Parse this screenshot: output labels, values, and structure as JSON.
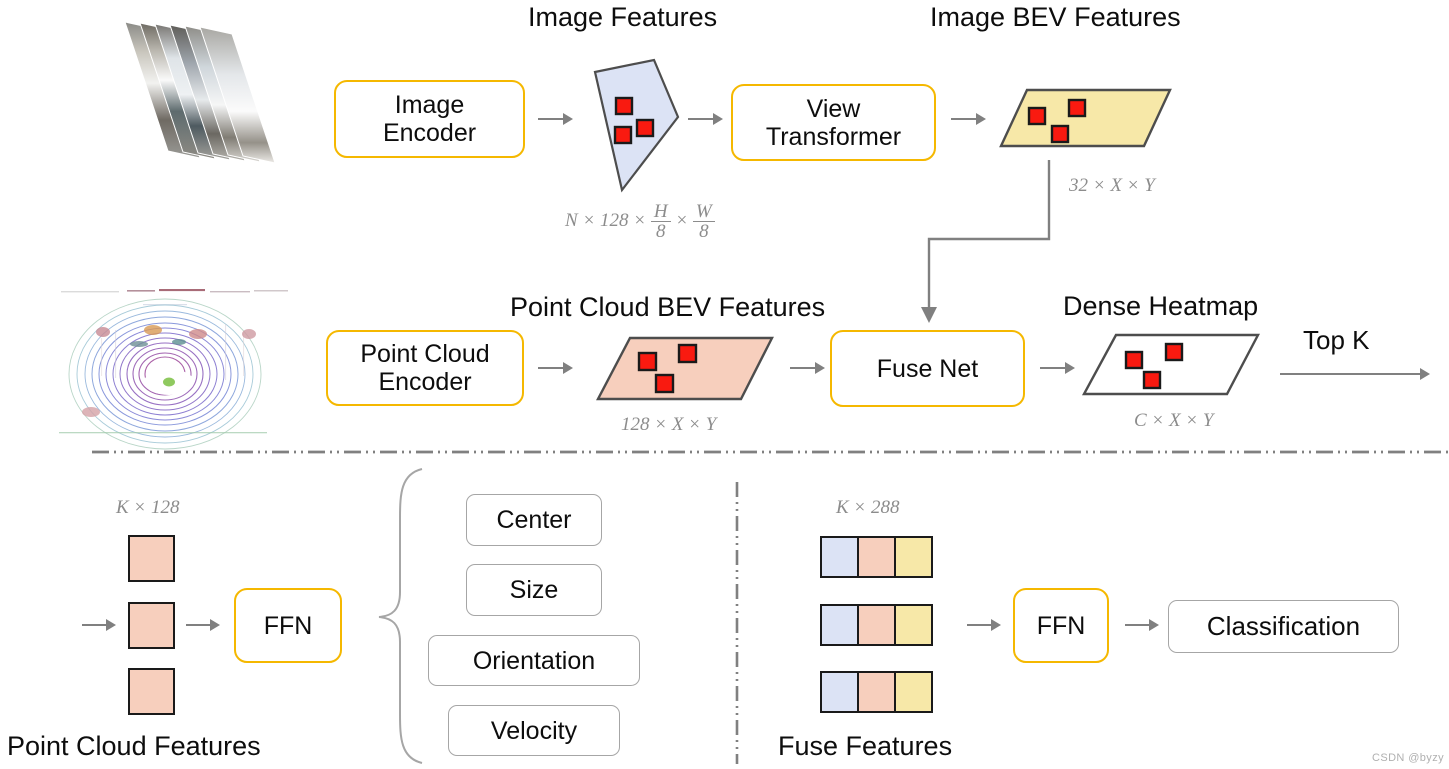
{
  "diagram": {
    "title_image_features": "Image Features",
    "title_image_bev_features": "Image BEV Features",
    "title_point_cloud_bev_features": "Point Cloud BEV Features",
    "title_dense_heatmap": "Dense Heatmap",
    "label_point_cloud_features": "Point Cloud Features",
    "label_fuse_features": "Fuse Features",
    "label_top_k": "Top K"
  },
  "blocks": {
    "image_encoder": "Image\nEncoder",
    "view_transformer": "View\nTransformer",
    "point_cloud_encoder": "Point Cloud\nEncoder",
    "fuse_net": "Fuse Net",
    "ffn_left": "FFN",
    "ffn_right": "FFN",
    "classification": "Classification"
  },
  "head_outputs": [
    {
      "label": "Center"
    },
    {
      "label": "Size"
    },
    {
      "label": "Orientation"
    },
    {
      "label": "Velocity"
    }
  ],
  "shape_captions": {
    "image_features": "N × 128 × H/8 × W/8",
    "image_features_parts": {
      "n": "N",
      "times1": "× 128 ×",
      "h": "H",
      "eight_a": "8",
      "times2": "×",
      "w": "W",
      "eight_b": "8"
    },
    "image_bev": "32 × X × Y",
    "point_cloud_bev": "128 × X × Y",
    "dense_heatmap": "C × X × Y",
    "point_cloud_features": "K × 128",
    "fuse_features": "K × 288"
  },
  "colors": {
    "accent_yellow": "#f5b800",
    "image_plane_fill": "#dce3f5",
    "image_bev_fill": "#f7e8a8",
    "point_cloud_fill": "#f7cfbd",
    "heatmap_fill": "#ffffff",
    "marker_red": "#f91a10",
    "outline_dark": "#4d4d4d",
    "arrow_gray": "#808080",
    "caption_gray": "#8c8c8c",
    "box_gray_border": "#a6a6a6"
  },
  "watermark": "CSDN @byzy"
}
